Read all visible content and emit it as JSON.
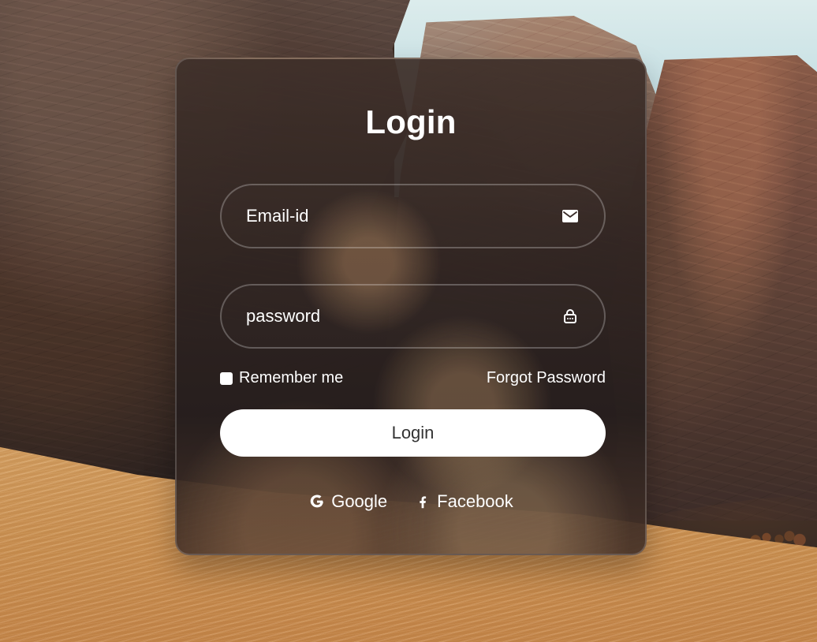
{
  "login_form": {
    "title": "Login",
    "email": {
      "value": "Email-id",
      "icon": "mail-icon"
    },
    "password": {
      "value": "password",
      "icon": "lock-icon"
    },
    "remember_me_label": "Remember me",
    "remember_me_checked": false,
    "forgot_password_label": "Forgot Password",
    "submit_label": "Login",
    "social": {
      "google_label": "Google",
      "facebook_label": "Facebook",
      "google_icon": "google-icon",
      "facebook_icon": "facebook-icon"
    }
  },
  "theme": {
    "card_text_color": "#ffffff",
    "button_background": "#ffffff",
    "button_text_color": "#333333",
    "sand_color": "#cf9555",
    "sky_color": "#c7e0e4"
  }
}
